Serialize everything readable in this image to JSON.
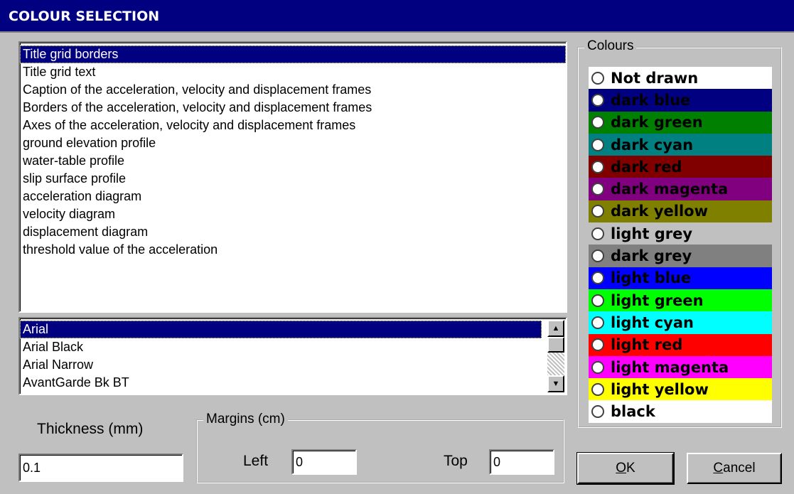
{
  "window": {
    "title": "COLOUR SELECTION"
  },
  "elements": {
    "selected_index": 0,
    "items": [
      "Title grid borders",
      "Title grid text",
      "Caption of the acceleration, velocity and displacement frames",
      "Borders of the acceleration, velocity and displacement frames",
      "Axes of the acceleration, velocity and displacement frames",
      "ground elevation profile",
      "water-table profile",
      "slip surface profile",
      "acceleration diagram",
      "velocity diagram",
      "displacement diagram",
      "threshold value of the acceleration"
    ]
  },
  "fonts": {
    "selected_index": 0,
    "items": [
      "Arial",
      "Arial Black",
      "Arial Narrow",
      "AvantGarde Bk BT"
    ],
    "scroll_up_icon": "triangle-up",
    "scroll_down_icon": "triangle-down"
  },
  "colours": {
    "label": "Colours",
    "selected_index": 16,
    "items": [
      {
        "name": "Not drawn",
        "bg": "#ffffff",
        "fg": "#000000"
      },
      {
        "name": "dark blue",
        "bg": "#000080",
        "fg": "#000000"
      },
      {
        "name": "dark green",
        "bg": "#008000",
        "fg": "#000000"
      },
      {
        "name": "dark cyan",
        "bg": "#008080",
        "fg": "#000000"
      },
      {
        "name": "dark red",
        "bg": "#800000",
        "fg": "#000000"
      },
      {
        "name": "dark magenta",
        "bg": "#800080",
        "fg": "#000000"
      },
      {
        "name": "dark yellow",
        "bg": "#808000",
        "fg": "#000000"
      },
      {
        "name": "light grey",
        "bg": "#c0c0c0",
        "fg": "#000000"
      },
      {
        "name": "dark grey",
        "bg": "#808080",
        "fg": "#000000"
      },
      {
        "name": "light blue",
        "bg": "#0000ff",
        "fg": "#000000"
      },
      {
        "name": "light green",
        "bg": "#00ff00",
        "fg": "#000000"
      },
      {
        "name": "light cyan",
        "bg": "#00ffff",
        "fg": "#000000"
      },
      {
        "name": "light red",
        "bg": "#ff0000",
        "fg": "#000000"
      },
      {
        "name": "light magenta",
        "bg": "#ff00ff",
        "fg": "#000000"
      },
      {
        "name": "light yellow",
        "bg": "#ffff00",
        "fg": "#000000"
      },
      {
        "name": "black",
        "bg": "#ffffff",
        "fg": "#000000"
      }
    ]
  },
  "thickness": {
    "label": "Thickness (mm)",
    "value": "0.1"
  },
  "margins": {
    "label": "Margins (cm)",
    "left_label": "Left",
    "left_value": "0",
    "top_label": "Top",
    "top_value": "0"
  },
  "buttons": {
    "ok": "OK",
    "cancel": "Cancel"
  }
}
